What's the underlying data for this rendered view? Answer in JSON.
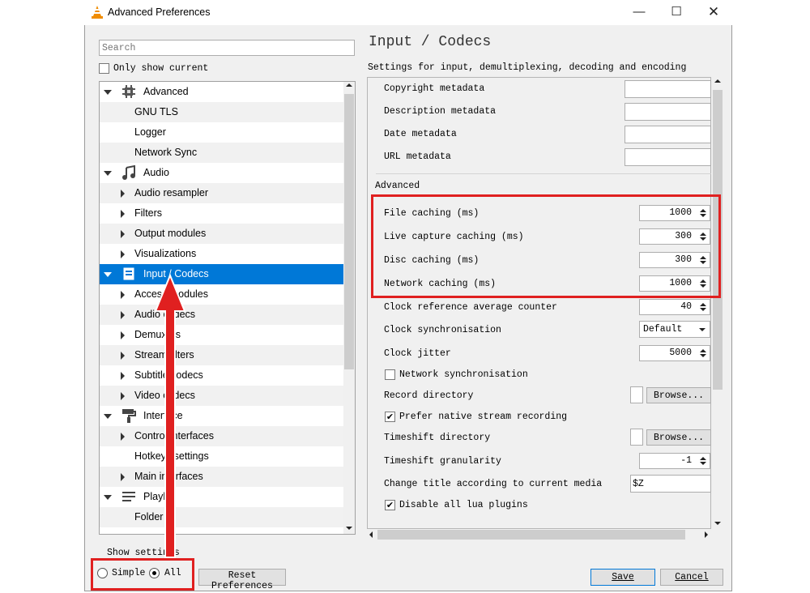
{
  "window": {
    "title": "Advanced Preferences",
    "minimize_icon": "minimize-icon",
    "maximize_icon": "maximize-icon",
    "close_icon": "close-icon"
  },
  "search": {
    "placeholder": "Search",
    "value": ""
  },
  "only_show_current": {
    "label": "Only show current",
    "checked": false
  },
  "tree": {
    "items": [
      {
        "label": "Advanced",
        "level": 0,
        "expander": "down",
        "icon": "advanced-chip-icon"
      },
      {
        "label": "GNU TLS",
        "level": 1,
        "expander": "none"
      },
      {
        "label": "Logger",
        "level": 1,
        "expander": "none"
      },
      {
        "label": "Network Sync",
        "level": 1,
        "expander": "none"
      },
      {
        "label": "Audio",
        "level": 0,
        "expander": "down",
        "icon": "audio-note-icon"
      },
      {
        "label": "Audio resampler",
        "level": 1,
        "expander": "right"
      },
      {
        "label": "Filters",
        "level": 1,
        "expander": "right"
      },
      {
        "label": "Output modules",
        "level": 1,
        "expander": "right"
      },
      {
        "label": "Visualizations",
        "level": 1,
        "expander": "right"
      },
      {
        "label": "Input / Codecs",
        "level": 0,
        "expander": "down",
        "icon": "input-codecs-icon",
        "selected": true
      },
      {
        "label": "Access modules",
        "level": 1,
        "expander": "right"
      },
      {
        "label": "Audio codecs",
        "level": 1,
        "expander": "right"
      },
      {
        "label": "Demuxers",
        "level": 1,
        "expander": "right"
      },
      {
        "label": "Stream filters",
        "level": 1,
        "expander": "right"
      },
      {
        "label": "Subtitle codecs",
        "level": 1,
        "expander": "right"
      },
      {
        "label": "Video codecs",
        "level": 1,
        "expander": "right"
      },
      {
        "label": "Interface",
        "level": 0,
        "expander": "down",
        "icon": "interface-brush-icon"
      },
      {
        "label": "Control interfaces",
        "level": 1,
        "expander": "right"
      },
      {
        "label": "Hotkeys settings",
        "level": 1,
        "expander": "none"
      },
      {
        "label": "Main interfaces",
        "level": 1,
        "expander": "right"
      },
      {
        "label": "Playlist",
        "level": 0,
        "expander": "down",
        "icon": "playlist-icon"
      },
      {
        "label": "Folder",
        "level": 1,
        "expander": "none"
      }
    ]
  },
  "show_settings": {
    "label": "Show settings",
    "options": [
      "Simple",
      "All"
    ],
    "selected": "All"
  },
  "buttons": {
    "reset": "Reset Preferences",
    "save": "Save",
    "cancel": "Cancel"
  },
  "panel": {
    "title": "Input / Codecs",
    "subtitle": "Settings for input, demultiplexing, decoding and encoding",
    "metadata_fields": [
      {
        "label": "Copyright metadata",
        "value": ""
      },
      {
        "label": "Description metadata",
        "value": ""
      },
      {
        "label": "Date metadata",
        "value": ""
      },
      {
        "label": "URL metadata",
        "value": ""
      }
    ],
    "advanced_header": "Advanced",
    "caching": [
      {
        "label": "File caching (ms)",
        "value": "1000"
      },
      {
        "label": "Live capture caching (ms)",
        "value": "300"
      },
      {
        "label": "Disc caching (ms)",
        "value": "300"
      },
      {
        "label": "Network caching (ms)",
        "value": "1000"
      }
    ],
    "clock_reference": {
      "label": "Clock reference average counter",
      "value": "40"
    },
    "clock_sync": {
      "label": "Clock synchronisation",
      "value": "Default"
    },
    "clock_jitter": {
      "label": "Clock jitter",
      "value": "5000"
    },
    "network_sync": {
      "label": "Network synchronisation",
      "checked": false
    },
    "record_directory": {
      "label": "Record directory",
      "button": "Browse...",
      "value": ""
    },
    "prefer_native": {
      "label": "Prefer native stream recording",
      "checked": true
    },
    "timeshift_directory": {
      "label": "Timeshift directory",
      "button": "Browse...",
      "value": ""
    },
    "timeshift_granularity": {
      "label": "Timeshift granularity",
      "value": "-1"
    },
    "change_title": {
      "label": "Change title according to current media",
      "value": "$Z"
    },
    "disable_lua": {
      "label": "Disable all lua plugins",
      "checked": true
    }
  },
  "colors": {
    "selection": "#0078d7",
    "highlight": "#e02020",
    "vlc_orange": "#f08c00"
  }
}
